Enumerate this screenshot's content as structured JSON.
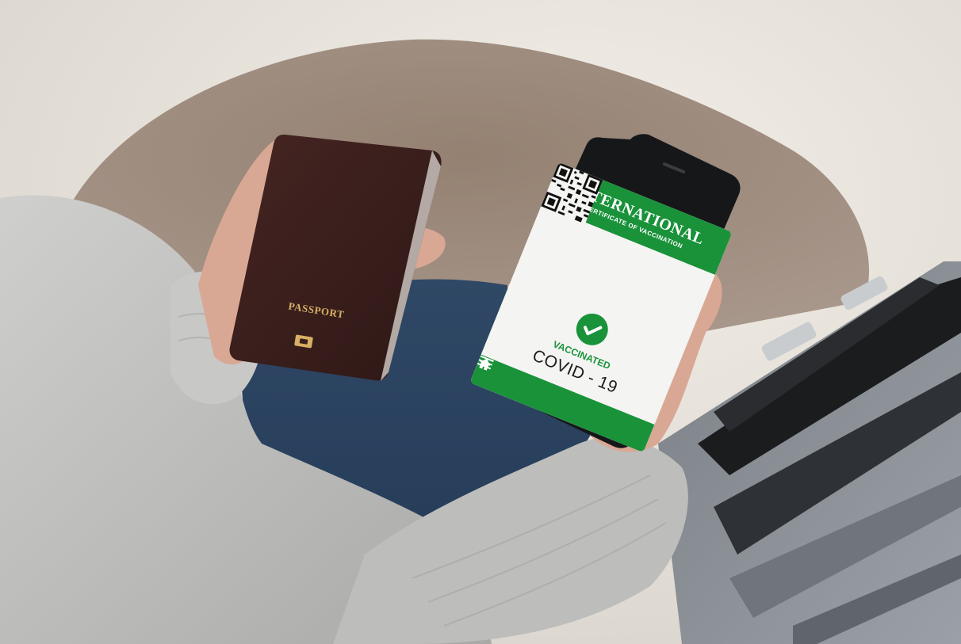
{
  "passport": {
    "label": "PASSPORT"
  },
  "phone": {
    "header_title": "INTERNATIONAL",
    "header_subtitle": "CERTIFICATE OF VACCINATION",
    "status_label": "VACCINATED",
    "disease_label": "COVID - 19",
    "footer_icons": [
      "home-icon",
      "menu-icon"
    ]
  },
  "colors": {
    "accent_green": "#19923a",
    "passport_brown": "#3a1f1c",
    "gold_text": "#d7b066"
  }
}
